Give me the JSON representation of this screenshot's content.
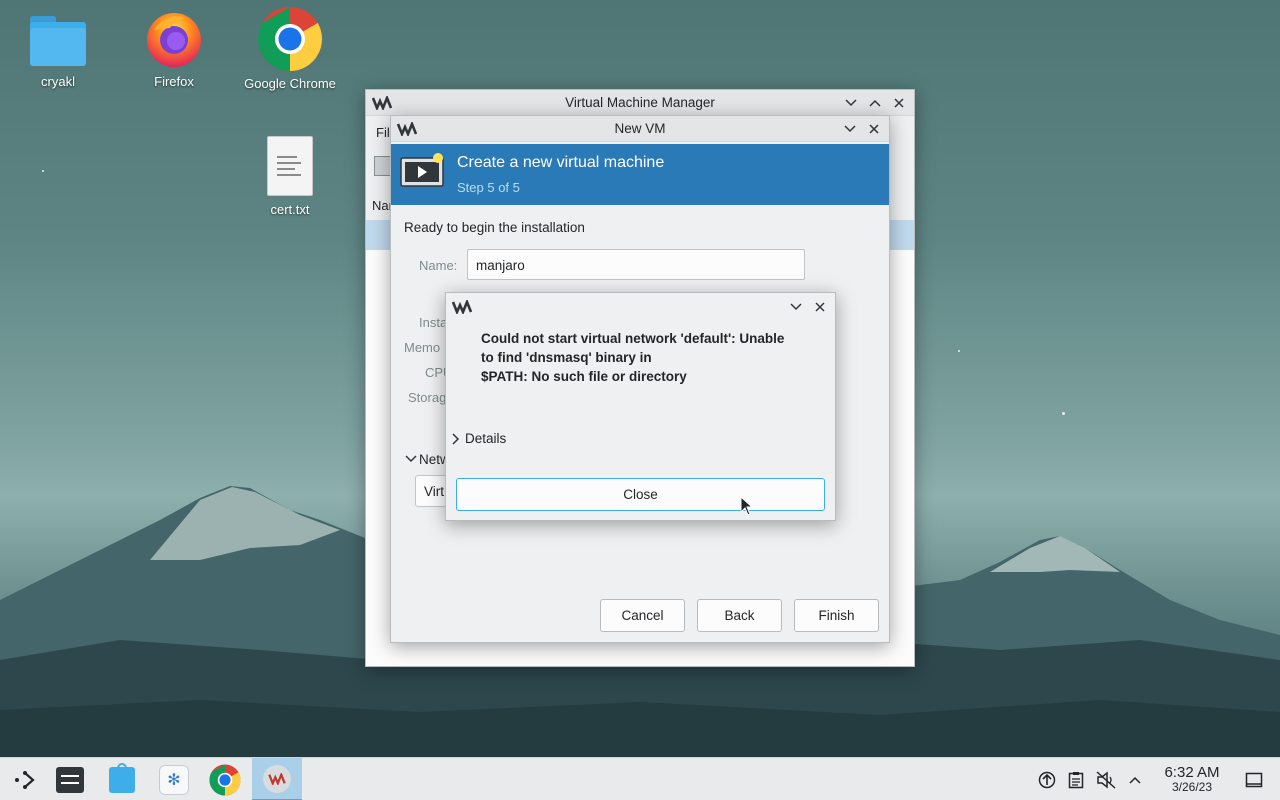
{
  "desktop": {
    "icons": [
      {
        "label": "cryakl",
        "icon": "folder-icon"
      },
      {
        "label": "Firefox",
        "icon": "firefox-icon"
      },
      {
        "label": "Google Chrome",
        "icon": "chrome-icon"
      },
      {
        "label": "cert.txt",
        "icon": "text-file-icon"
      }
    ]
  },
  "vmm_window": {
    "title": "Virtual Machine Manager",
    "menu_file_partial": "File",
    "column_name_partial": "Nam"
  },
  "newvm_window": {
    "title": "New VM",
    "header_title": "Create a new virtual machine",
    "header_step": "Step 5 of 5",
    "ready_text": "Ready to begin the installation",
    "name_label": "Name:",
    "name_value": "manjaro",
    "hidden_labels": [
      "Install",
      "Memory",
      "CPUs",
      "Storage"
    ],
    "hidden_label_partials": [
      "Insta",
      "Memo",
      "CPU",
      "Storag"
    ],
    "network_section_partial": "Netw",
    "network_select_partial": "Virt",
    "buttons": {
      "cancel": "Cancel",
      "back": "Back",
      "finish": "Finish"
    }
  },
  "error_dialog": {
    "message_line1": "Could not start virtual network 'default': Unable",
    "message_line2": "to find 'dnsmasq' binary in",
    "message_line3": "$PATH: No such file or directory",
    "details_label": "Details",
    "close_label": "Close"
  },
  "taskbar": {
    "items": [
      "application-launcher-icon",
      "system-settings-icon",
      "discover-store-icon",
      "vm-tool-icon",
      "chrome-icon",
      "virt-manager-icon"
    ],
    "clock_time": "6:32 AM",
    "clock_date": "3/26/23"
  },
  "colors": {
    "header_blue": "#2a7ab8",
    "header_step": "#b9dcf5",
    "focus_blue": "#3daee9"
  }
}
